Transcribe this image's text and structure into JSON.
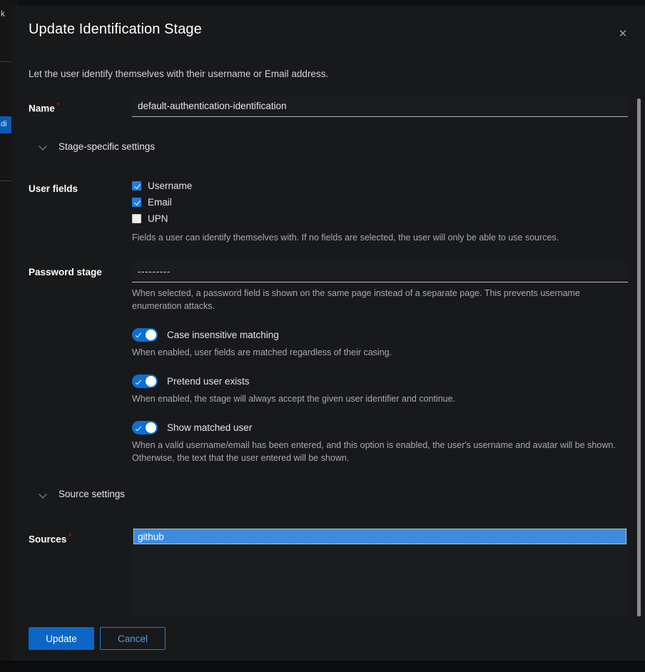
{
  "background": {
    "sliver_text": "k",
    "sliver_selected_text": "di"
  },
  "modal": {
    "title": "Update Identification Stage",
    "close_icon": "close-icon",
    "description": "Let the user identify themselves with their username or Email address.",
    "name_field": {
      "label": "Name",
      "required_marker": "*",
      "value": "default-authentication-identification"
    },
    "sections": [
      {
        "title": "Stage-specific settings",
        "chevron_icon": "chevron-down-icon"
      },
      {
        "title": "Source settings",
        "chevron_icon": "chevron-down-icon"
      }
    ],
    "user_fields": {
      "label": "User fields",
      "options": [
        {
          "label": "Username",
          "checked": true
        },
        {
          "label": "Email",
          "checked": true
        },
        {
          "label": "UPN",
          "checked": false
        }
      ],
      "helper": "Fields a user can identify themselves with. If no fields are selected, the user will only be able to use sources."
    },
    "password_stage": {
      "label": "Password stage",
      "value": "---------",
      "helper": "When selected, a password field is shown on the same page instead of a separate page. This prevents username enumeration attacks."
    },
    "toggles": [
      {
        "label": "Case insensitive matching",
        "enabled": true,
        "helper": "When enabled, user fields are matched regardless of their casing."
      },
      {
        "label": "Pretend user exists",
        "enabled": true,
        "helper": "When enabled, the stage will always accept the given user identifier and continue."
      },
      {
        "label": "Show matched user",
        "enabled": true,
        "helper": "When a valid username/email has been entered, and this option is enabled, the user's username and avatar will be shown. Otherwise, the text that the user entered will be shown."
      }
    ],
    "sources": {
      "label": "Sources",
      "required_marker": "*",
      "options": [
        {
          "label": "github",
          "selected": true
        }
      ],
      "scroll_arrow_icon": "caret-down-icon"
    },
    "footer": {
      "submit_label": "Update",
      "cancel_label": "Cancel"
    }
  },
  "colors": {
    "accent": "#0c66c6",
    "toggle_on": "#0b6fd4",
    "checkbox_on": "#1f7de0",
    "selection": "#3c8bdd",
    "required": "#c9190b",
    "modal_bg": "#18191b",
    "page_bg": "#0f1011"
  }
}
